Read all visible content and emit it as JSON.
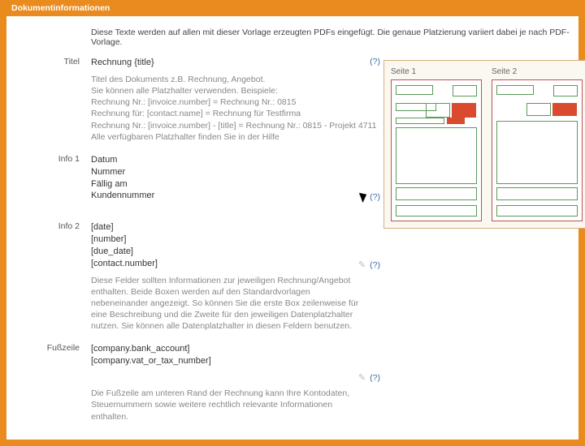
{
  "header": {
    "tab": "Dokumentinformationen"
  },
  "intro": "Diese Texte werden auf allen mit dieser Vorlage erzeugten PDFs eingefügt. Die genaue Platzierung variiert dabei je nach PDF-Vorlage.",
  "titel": {
    "label": "Titel",
    "value": "Rechnung {title}",
    "help": "(?)",
    "hint_lines": [
      "Titel des Dokuments z.B. Rechnung, Angebot.",
      "Sie können alle Platzhalter verwenden. Beispiele:",
      "Rechnung Nr.: [invoice.number] = Rechnung Nr.: 0815",
      "Rechnung für: [contact.name] = Rechnung für Testfirma",
      "Rechnung Nr.: [invoice.number] - [title] = Rechnung Nr.: 0815 - Projekt 4711",
      "Alle verfügbaren Platzhalter finden Sie in der Hilfe"
    ]
  },
  "info1": {
    "label": "Info 1",
    "lines": [
      "Datum",
      "Nummer",
      "Fällig am",
      "Kundennummer"
    ],
    "help": "(?)"
  },
  "info2": {
    "label": "Info 2",
    "lines": [
      "[date]",
      "[number]",
      "[due_date]",
      "[contact.number]"
    ],
    "help": "(?)",
    "hint": "Diese Felder sollten Informationen zur jeweiligen Rechnung/Angebot enthalten. Beide Boxen werden auf den Standardvorlagen nebeneinander angezeigt. So können Sie die erste Box zeilenweise für eine Beschreibung und die Zweite für den jeweiligen Datenplatzhalter nutzen. Sie können alle Datenplatzhalter in diesen Feldern benutzen."
  },
  "fusszeile": {
    "label": "Fußzeile",
    "lines": [
      "[company.bank_account]",
      "[company.vat_or_tax_number]"
    ],
    "help": "(?)",
    "hint": "Die Fußzeile am unteren Rand der Rechnung kann Ihre Kontodaten, Steuernummern sowie weitere rechtlich relevante Informationen enthalten."
  },
  "preview": {
    "page1": "Seite 1",
    "page2": "Seite 2"
  },
  "edit_glyph": "✎"
}
